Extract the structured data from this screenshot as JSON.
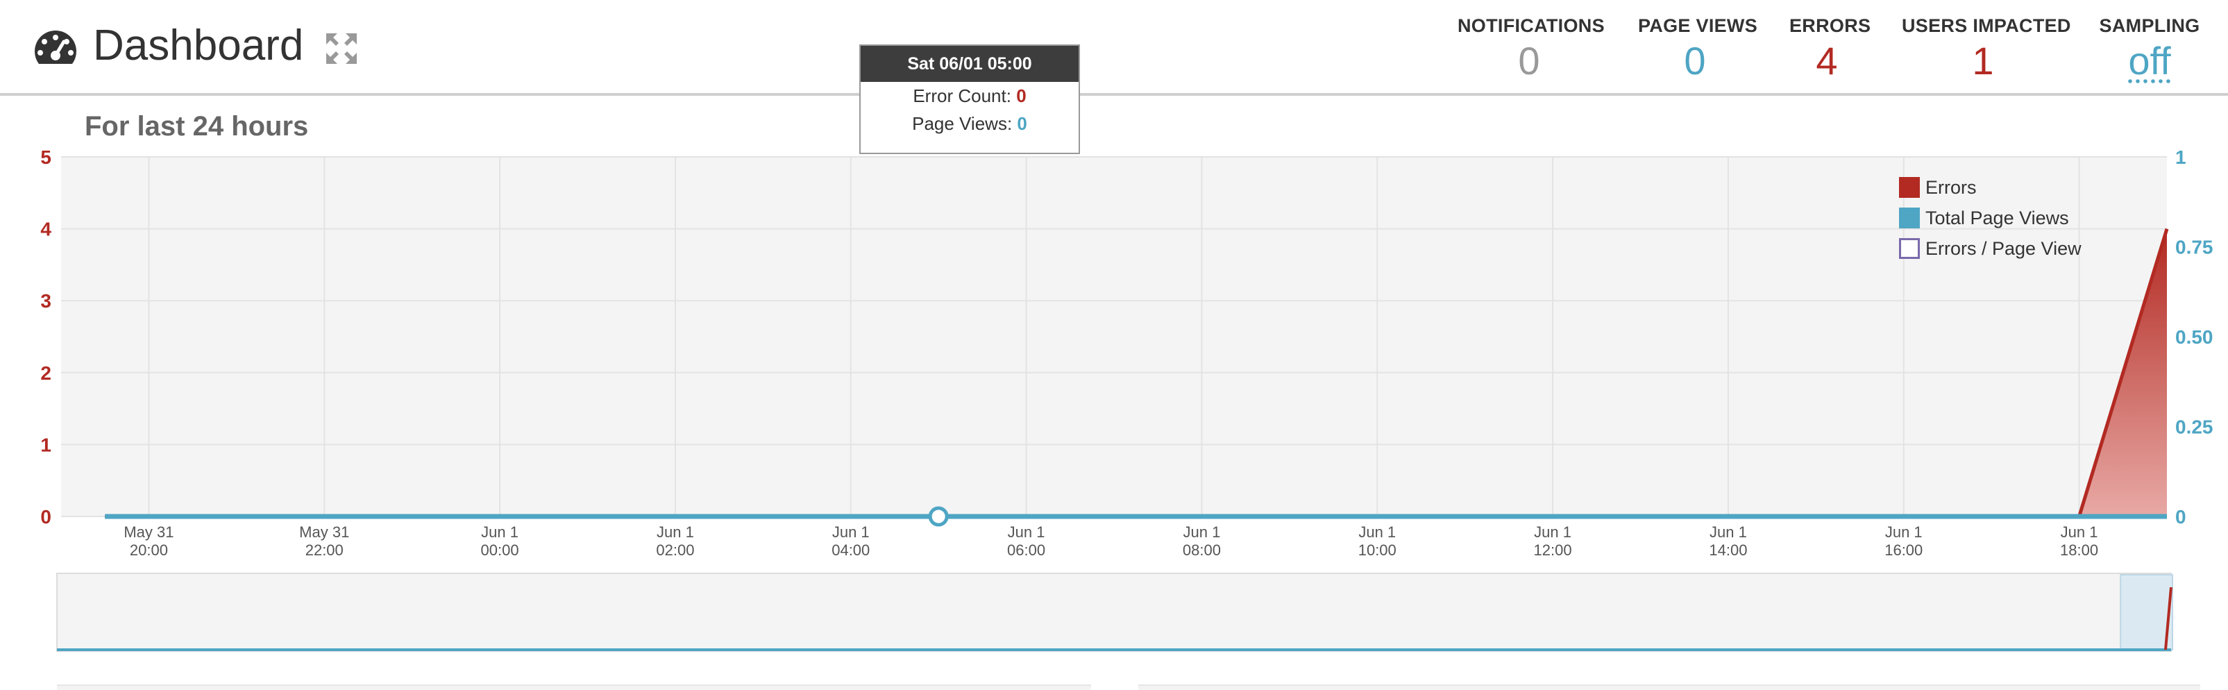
{
  "header": {
    "title": "Dashboard",
    "stats": [
      {
        "label": "NOTIFICATIONS",
        "value": "0",
        "color": "#999999"
      },
      {
        "label": "PAGE VIEWS",
        "value": "0",
        "color": "#4ea5c4"
      },
      {
        "label": "ERRORS",
        "value": "4",
        "color": "#b22a22"
      },
      {
        "label": "USERS IMPACTED",
        "value": "1",
        "color": "#b22a22"
      },
      {
        "label": "SAMPLING",
        "value": "off",
        "color": "#4ea5c4"
      }
    ]
  },
  "subtitle": "For last 24 hours",
  "tooltip": {
    "title": "Sat 06/01 05:00",
    "error_label": "Error Count:",
    "error_value": "0",
    "views_label": "Page Views:",
    "views_value": "0"
  },
  "legend": [
    {
      "label": "Errors",
      "color": "#b22a22",
      "style": "filled"
    },
    {
      "label": "Total Page Views",
      "color": "#4ea5c4",
      "style": "filled"
    },
    {
      "label": "Errors / Page View",
      "color": "#7a6aab",
      "style": "outline"
    }
  ],
  "chart_data": {
    "type": "area",
    "x": [
      "May 31 19:30",
      "May 31 20:00",
      "May 31 22:00",
      "Jun 1 00:00",
      "Jun 1 02:00",
      "Jun 1 04:00",
      "Jun 1 06:00",
      "Jun 1 08:00",
      "Jun 1 10:00",
      "Jun 1 12:00",
      "Jun 1 14:00",
      "Jun 1 16:00",
      "Jun 1 18:00",
      "Jun 1 19:00"
    ],
    "x_hours": [
      -0.5,
      0,
      2,
      4,
      6,
      8,
      10,
      12,
      14,
      16,
      18,
      20,
      22,
      23
    ],
    "x_range": [
      -1,
      23
    ],
    "series": [
      {
        "name": "Errors",
        "axis": "left",
        "color": "#b22a22",
        "values": [
          0,
          0,
          0,
          0,
          0,
          0,
          0,
          0,
          0,
          0,
          0,
          0,
          0,
          4
        ]
      },
      {
        "name": "Total Page Views",
        "axis": "right",
        "color": "#4ea5c4",
        "values": [
          0,
          0,
          0,
          0,
          0,
          0,
          0,
          0,
          0,
          0,
          0,
          0,
          0,
          0
        ]
      }
    ],
    "highlight_point": {
      "x_hours": 9,
      "value": 0
    },
    "left_axis": {
      "ticks": [
        "0",
        "1",
        "2",
        "3",
        "4",
        "5"
      ],
      "range": [
        0,
        5
      ],
      "color": "#b22a22"
    },
    "right_axis": {
      "ticks": [
        "0",
        "0.25",
        "0.50",
        "0.75",
        "1"
      ],
      "range": [
        0,
        1
      ],
      "color": "#4ea5c4"
    },
    "x_ticks": [
      {
        "hours": 0,
        "line1": "May 31",
        "line2": "20:00"
      },
      {
        "hours": 2,
        "line1": "May 31",
        "line2": "22:00"
      },
      {
        "hours": 4,
        "line1": "Jun 1",
        "line2": "00:00"
      },
      {
        "hours": 6,
        "line1": "Jun 1",
        "line2": "02:00"
      },
      {
        "hours": 8,
        "line1": "Jun 1",
        "line2": "04:00"
      },
      {
        "hours": 10,
        "line1": "Jun 1",
        "line2": "06:00"
      },
      {
        "hours": 12,
        "line1": "Jun 1",
        "line2": "08:00"
      },
      {
        "hours": 14,
        "line1": "Jun 1",
        "line2": "10:00"
      },
      {
        "hours": 16,
        "line1": "Jun 1",
        "line2": "12:00"
      },
      {
        "hours": 18,
        "line1": "Jun 1",
        "line2": "14:00"
      },
      {
        "hours": 20,
        "line1": "Jun 1",
        "line2": "16:00"
      },
      {
        "hours": 22,
        "line1": "Jun 1",
        "line2": "18:00"
      }
    ],
    "grid": true,
    "legend_position": "top-right",
    "navigator_range_hours": [
      22.6,
      23
    ]
  }
}
